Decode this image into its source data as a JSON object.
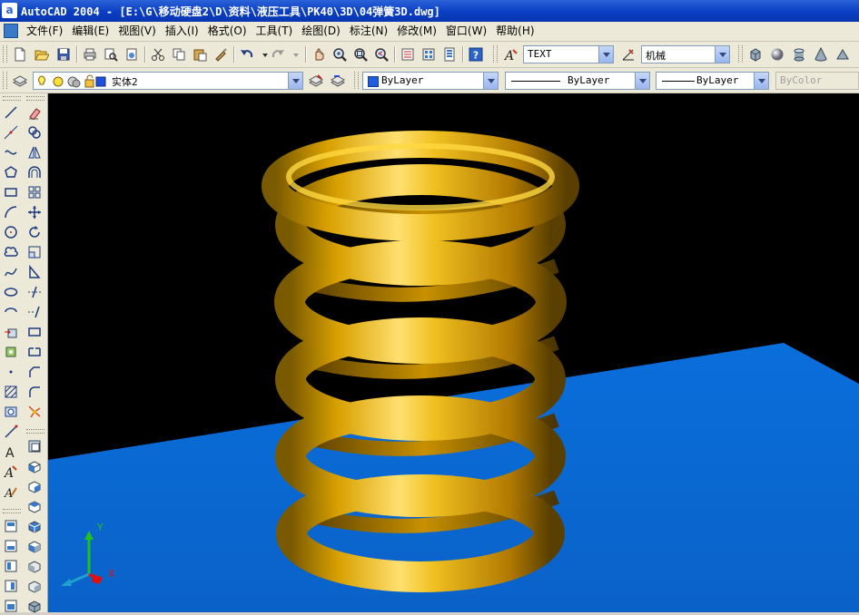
{
  "window": {
    "app_icon_letter": "a",
    "title": "AutoCAD 2004 - [E:\\G\\移动硬盘2\\D\\资料\\液压工具\\PK40\\3D\\04弹簧3D.dwg]"
  },
  "menubar": {
    "items": [
      "文件(F)",
      "编辑(E)",
      "视图(V)",
      "插入(I)",
      "格式(O)",
      "工具(T)",
      "绘图(D)",
      "标注(N)",
      "修改(M)",
      "窗口(W)",
      "帮助(H)"
    ]
  },
  "toolbar": {
    "text_style": "TEXT",
    "dim_style": "机械",
    "layer": "实体2",
    "color": "ByLayer",
    "linetype": "ByLayer",
    "lineweight": "ByLayer",
    "plotstyle": "ByColor"
  },
  "ucs": {
    "x_label": "X",
    "y_label": "Y"
  },
  "colors": {
    "viewport_background": "#000000",
    "ground_plane": "#0a6edb",
    "spring": "#e0a800",
    "title_bar": "#0a3ec3"
  },
  "icons": {
    "standard": [
      "new-icon",
      "open-icon",
      "save-icon",
      "plot-icon",
      "plot-preview-icon",
      "publish-icon",
      "cut-icon",
      "copy-icon",
      "paste-icon",
      "match-properties-icon",
      "undo-icon",
      "redo-icon",
      "pan-icon",
      "zoom-realtime-icon",
      "zoom-window-icon",
      "zoom-previous-icon",
      "properties-icon",
      "designcenter-icon",
      "tool-palettes-icon",
      "help-icon"
    ],
    "shapes": [
      "box-icon",
      "sphere-icon",
      "cylinder-icon",
      "cone-icon",
      "wedge-icon"
    ]
  }
}
